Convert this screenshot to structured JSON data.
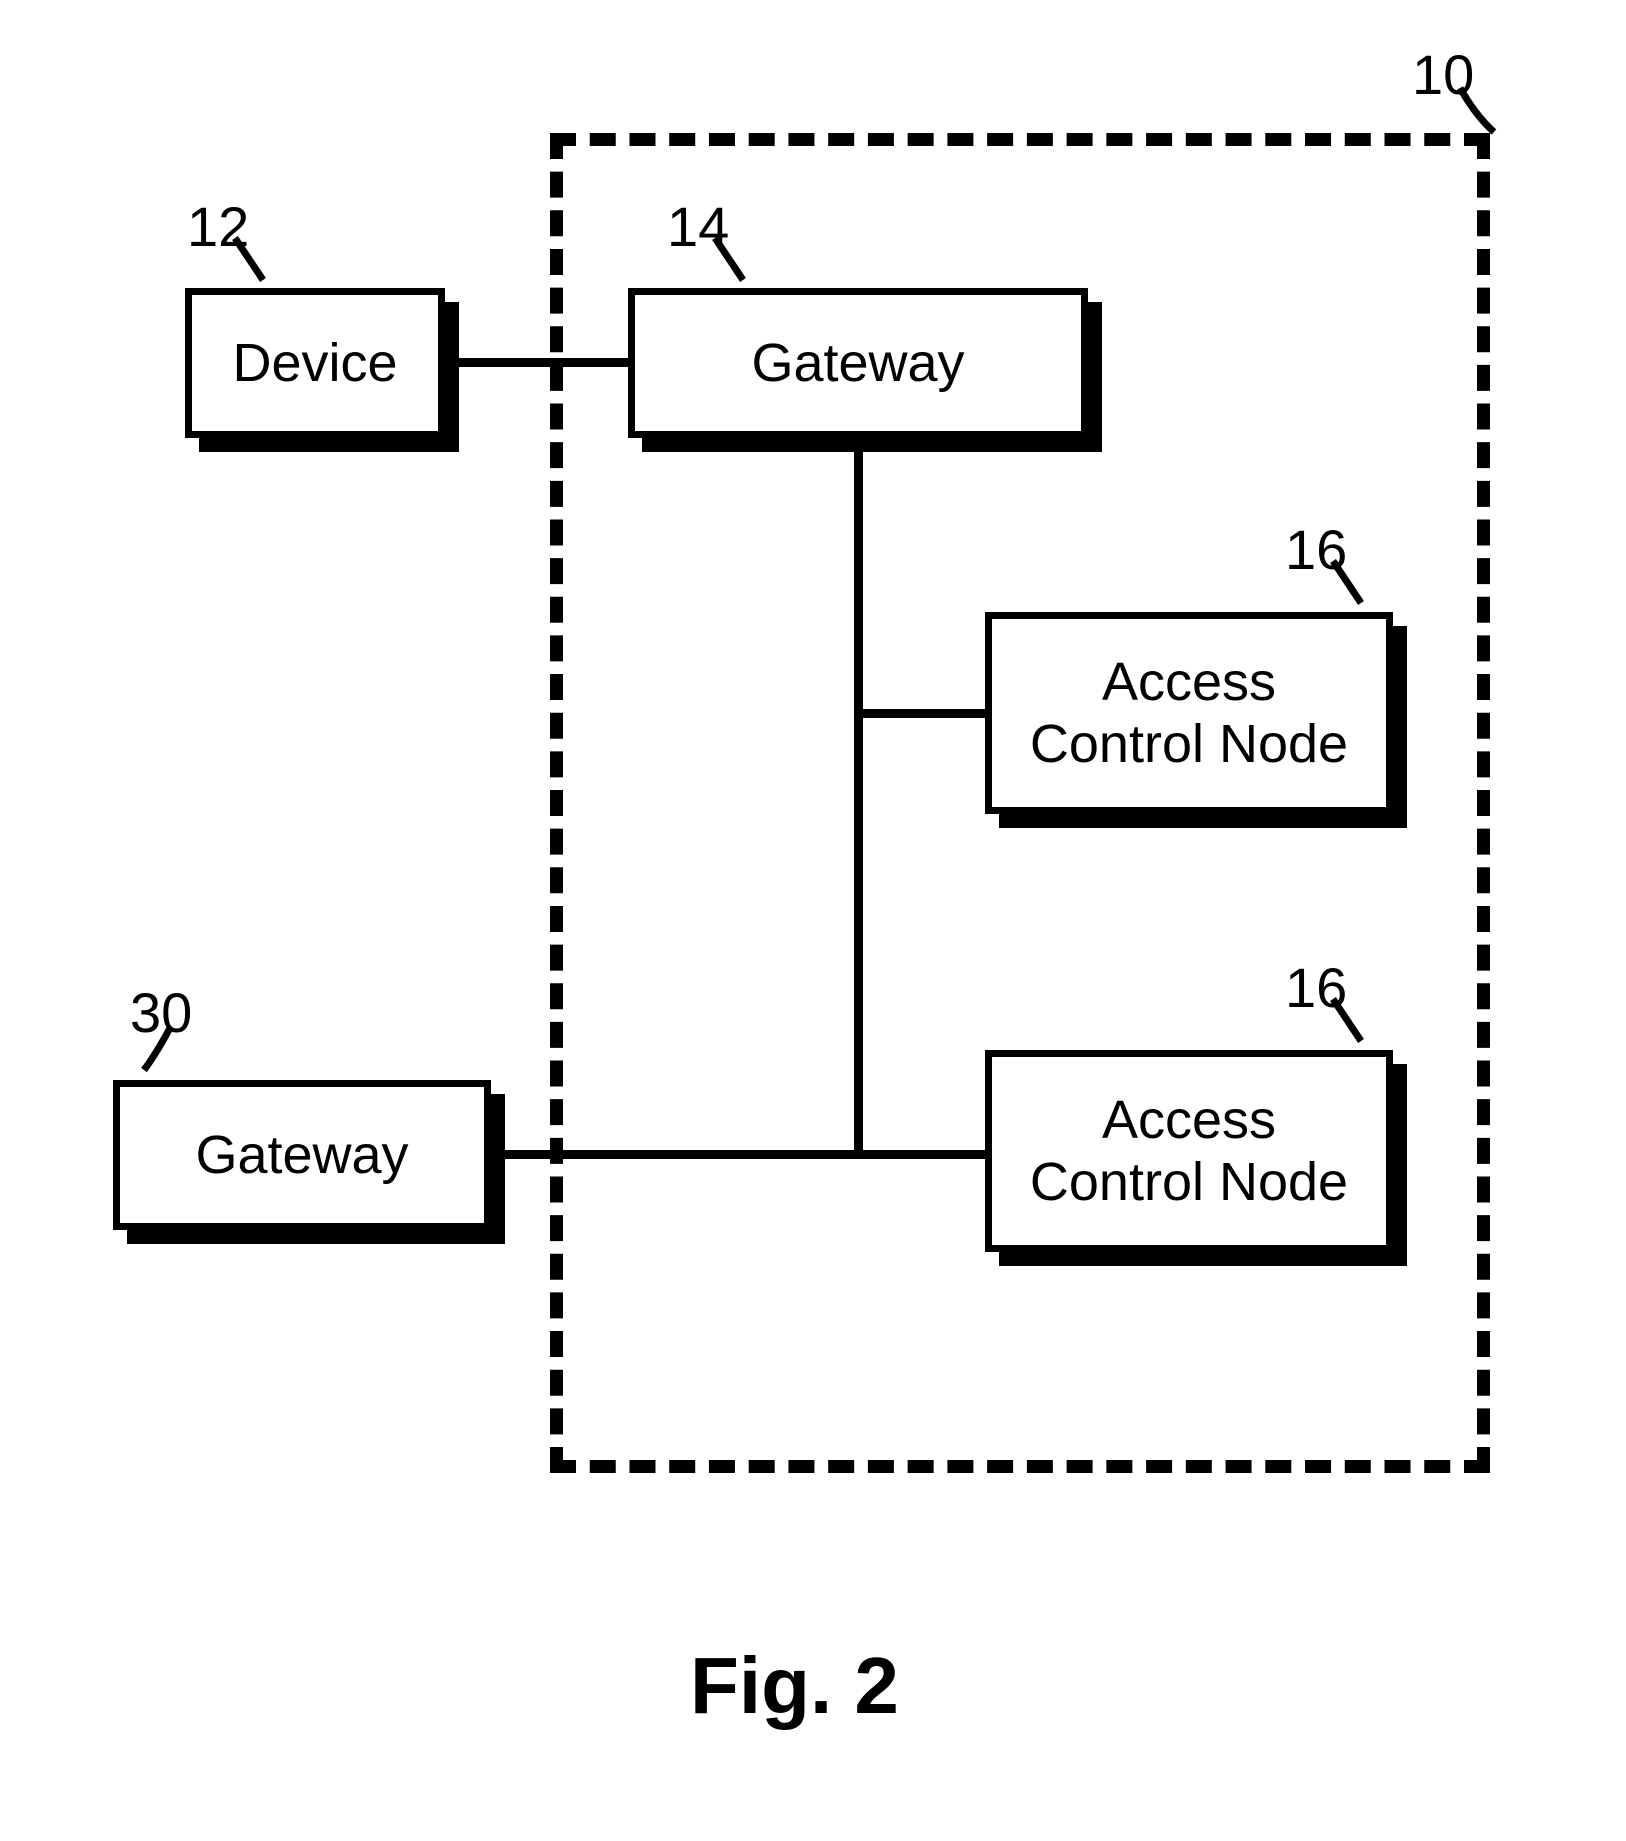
{
  "labels": {
    "boundary": "10",
    "device": "12",
    "gateway14": "14",
    "acn1": "16",
    "acn2": "16",
    "gateway30": "30"
  },
  "nodes": {
    "device": "Device",
    "gateway14": "Gateway",
    "acn1": "Access\nControl Node",
    "acn2": "Access\nControl Node",
    "gateway30": "Gateway"
  },
  "caption": "Fig. 2"
}
